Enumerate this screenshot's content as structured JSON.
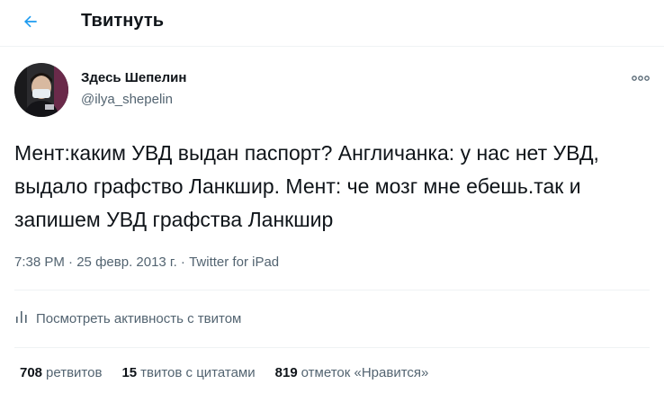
{
  "header": {
    "title": "Твитнуть",
    "back_icon": "arrow-left-icon"
  },
  "author": {
    "name": "Здесь Шепелин",
    "handle": "@ilya_shepelin"
  },
  "more_icon": "more-dots-icon",
  "tweet": {
    "text": "Мент:каким УВД выдан паспорт? Англичанка: у нас нет УВД, выдало графство Ланкшир. Мент: че мозг мне ебешь.так и запишем УВД графства Ланкшир"
  },
  "meta": {
    "time": "7:38 PM",
    "date": "25 февр. 2013 г.",
    "separator": "·",
    "source": "Twitter for iPad"
  },
  "activity": {
    "label": "Посмотреть активность с твитом",
    "icon": "analytics-icon"
  },
  "stats": {
    "retweets": {
      "count": "708",
      "label": "ретвитов"
    },
    "quotes": {
      "count": "15",
      "label": "твитов с цитатами"
    },
    "likes": {
      "count": "819",
      "label": "отметок «Нравится»"
    }
  },
  "colors": {
    "accent": "#1d9bf0",
    "muted": "#536471",
    "text": "#0f1419"
  }
}
